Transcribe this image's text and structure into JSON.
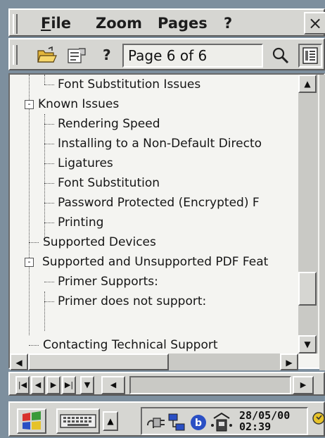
{
  "menu": {
    "file": {
      "first": "F",
      "rest": "ile"
    },
    "zoom": "Zoom",
    "pages": "Pages",
    "help": "?",
    "close": "×"
  },
  "toolbar": {
    "help": "?",
    "page_status": "Page 6 of 6",
    "icons": [
      "open-folder-icon",
      "properties-icon",
      "magnifier-icon",
      "outline-view-icon"
    ]
  },
  "tree": {
    "items": [
      {
        "label": "Font Substitution Issues",
        "level": 2,
        "expander": ""
      },
      {
        "label": "Known Issues",
        "level": 1,
        "expander": "-"
      },
      {
        "label": "Rendering Speed",
        "level": 2,
        "expander": ""
      },
      {
        "label": "Installing to a Non-Default Directo",
        "level": 2,
        "expander": ""
      },
      {
        "label": "Ligatures",
        "level": 2,
        "expander": ""
      },
      {
        "label": "Font Substitution",
        "level": 2,
        "expander": ""
      },
      {
        "label": "Password Protected (Encrypted) F",
        "level": 2,
        "expander": ""
      },
      {
        "label": "Printing",
        "level": 2,
        "expander": ""
      },
      {
        "label": "Supported Devices",
        "level": 1,
        "expander": ""
      },
      {
        "label": "Supported and Unsupported PDF Feat",
        "level": 1,
        "expander": "-"
      },
      {
        "label": "Primer Supports:",
        "level": 2,
        "expander": ""
      },
      {
        "label": "Primer does not support:",
        "level": 2,
        "expander": ""
      },
      {
        "label": "Contacting Technical Support",
        "level": 1,
        "expander": ""
      }
    ]
  },
  "taskbar": {
    "clock_date": "28/05/00",
    "clock_time": "02:39"
  },
  "colors": {
    "face": "#d6d6d2",
    "tree_bg": "#f4f4f1",
    "accent_blue": "#2a4fc4"
  }
}
